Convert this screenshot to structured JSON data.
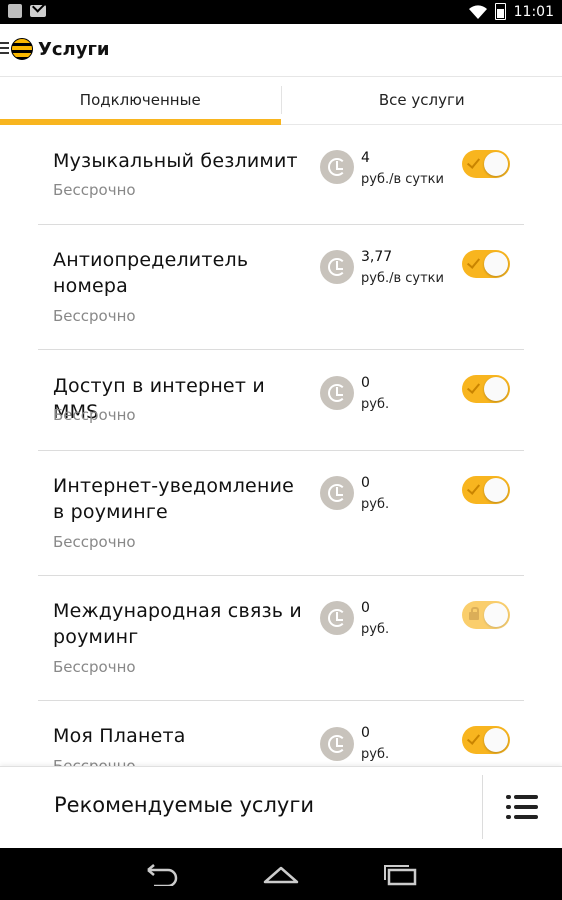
{
  "statusbar": {
    "time": "11:01",
    "icons": [
      "image-notification-icon",
      "mail-icon",
      "wifi-icon",
      "battery-icon"
    ]
  },
  "header": {
    "title": "Услуги"
  },
  "tabs": [
    {
      "label": "Подключенные",
      "active": true
    },
    {
      "label": "Все услуги",
      "active": false
    }
  ],
  "services": [
    {
      "name": "Музыкальный безлимит",
      "period": "Бессрочно",
      "price": "4",
      "unit": "руб./в сутки",
      "enabled": true,
      "locked": false
    },
    {
      "name": "Антиопределитель номера",
      "period": "Бессрочно",
      "price": "3,77",
      "unit": "руб./в сутки",
      "enabled": true,
      "locked": false
    },
    {
      "name": "Доступ в интернет и MMS",
      "period": "Бессрочно",
      "price": "0",
      "unit": "руб.",
      "enabled": true,
      "locked": false
    },
    {
      "name": "Интернет-уведомление в роуминге",
      "period": "Бессрочно",
      "price": "0",
      "unit": "руб.",
      "enabled": true,
      "locked": false
    },
    {
      "name": "Международная связь и роуминг",
      "period": "Бессрочно",
      "price": "0",
      "unit": "руб.",
      "enabled": true,
      "locked": true
    },
    {
      "name": "Моя Планета",
      "period": "Бессрочно",
      "price": "0",
      "unit": "руб.",
      "enabled": true,
      "locked": false
    }
  ],
  "bottom": {
    "recommended_label": "Рекомендуемые услуги"
  },
  "colors": {
    "accent": "#f8b51f",
    "clock_bg": "#c8c3bc"
  }
}
